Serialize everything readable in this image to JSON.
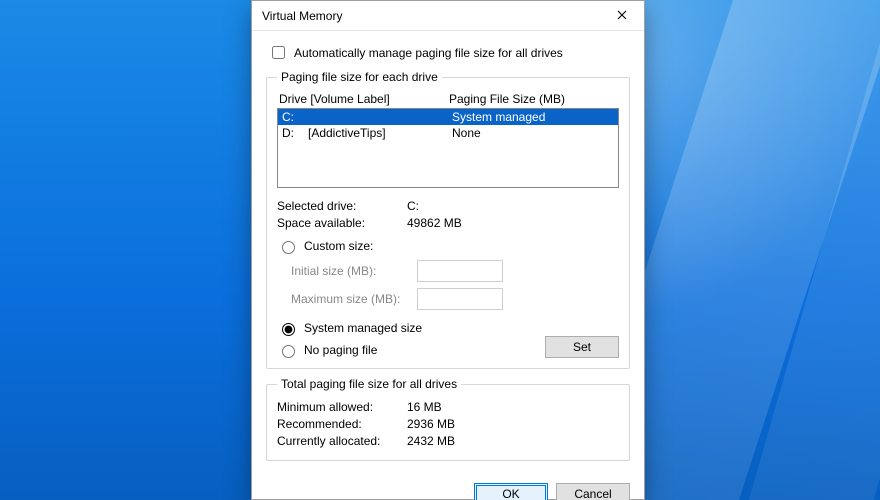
{
  "window": {
    "title": "Virtual Memory"
  },
  "auto_manage": {
    "label": "Automatically manage paging file size for all drives",
    "checked": false
  },
  "drives_group": {
    "legend": "Paging file size for each drive",
    "col_drive_label": "Drive  [Volume Label]",
    "col_size_label": "Paging File Size (MB)",
    "rows": [
      {
        "drive": "C:",
        "volume": "",
        "size": "System managed",
        "selected": true
      },
      {
        "drive": "D:",
        "volume": "[AddictiveTips]",
        "size": "None",
        "selected": false
      }
    ],
    "selected_drive_label": "Selected drive:",
    "selected_drive_value": "C:",
    "space_available_label": "Space available:",
    "space_available_value": "49862 MB",
    "opt_custom": "Custom size:",
    "initial_label": "Initial size (MB):",
    "maximum_label": "Maximum size (MB):",
    "opt_system": "System managed size",
    "opt_none": "No paging file",
    "set_btn": "Set",
    "selected_option": "system"
  },
  "totals_group": {
    "legend": "Total paging file size for all drives",
    "min_label": "Minimum allowed:",
    "min_value": "16 MB",
    "rec_label": "Recommended:",
    "rec_value": "2936 MB",
    "cur_label": "Currently allocated:",
    "cur_value": "2432 MB"
  },
  "buttons": {
    "ok": "OK",
    "cancel": "Cancel"
  }
}
